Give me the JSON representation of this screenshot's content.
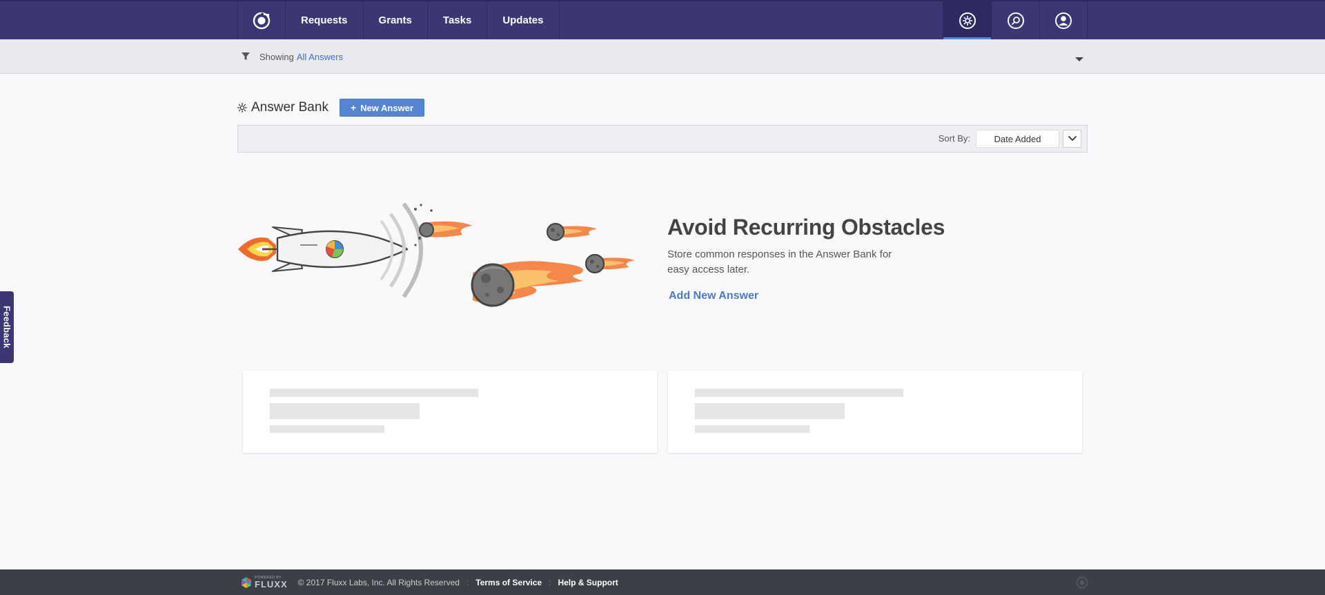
{
  "nav": {
    "logo_icon": "fluxx-logo-icon",
    "tabs": [
      {
        "label": "Requests"
      },
      {
        "label": "Grants"
      },
      {
        "label": "Tasks"
      },
      {
        "label": "Updates"
      }
    ],
    "right_icons": [
      "settings-gear-icon",
      "search-icon",
      "user-profile-icon"
    ],
    "active_right_icon": "settings-gear-icon",
    "accent": "#5a86d6"
  },
  "filter": {
    "prefix": "Showing",
    "value": "All Answers"
  },
  "page": {
    "title": "Answer Bank",
    "new_button": "New Answer",
    "new_button_icon": "+"
  },
  "sort": {
    "label": "Sort By:",
    "value": "Date Added"
  },
  "empty_state": {
    "title": "Avoid Recurring Obstacles",
    "description": "Store common responses in the Answer Bank for easy access later.",
    "link": "Add New Answer"
  },
  "feedback": {
    "label": "Feedback"
  },
  "footer": {
    "powered_by": "POWERED BY",
    "brand": "FLUXX",
    "copyright": "© 2017 Fluxx Labs, Inc. All Rights Reserved",
    "links": [
      "Terms of Service",
      "Help & Support"
    ]
  },
  "colors": {
    "nav_bg": "#3b3775",
    "link": "#4a79cc",
    "button": "#5584d3",
    "footer_bg": "#3d3f47"
  }
}
